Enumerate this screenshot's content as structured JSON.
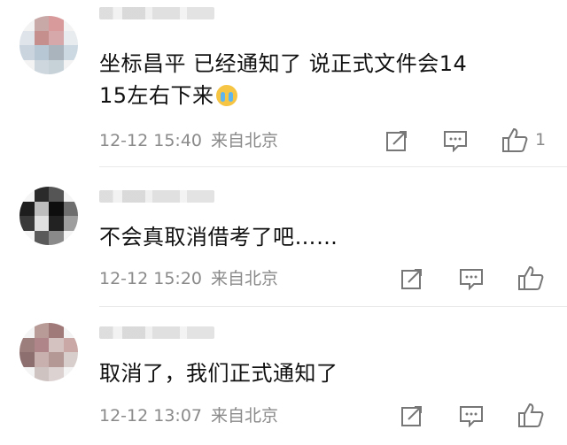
{
  "comments": [
    {
      "text_line1": "坐标昌平 已经通知了 说正式文件会14",
      "text_line2": "15左右下来",
      "time": "12-12 15:40",
      "location": "来自北京",
      "like_count": "1",
      "avatar_colors": [
        "#f3f3f3",
        "#c9a9a8",
        "#d99a9c",
        "#f3f3f3",
        "#dfe4ea",
        "#c48f8d",
        "#d6a8a9",
        "#e8ecef",
        "#c9d4de",
        "#b7c7d4",
        "#a9b4bd",
        "#cdd9e2",
        "#f3f3f3",
        "#cfd7de",
        "#c6d1d8",
        "#f3f3f3"
      ]
    },
    {
      "text_line1": "不会真取消借考了吧……",
      "time": "12-12 15:20",
      "location": "来自北京",
      "avatar_colors": [
        "#f5f5f5",
        "#2a2a2a",
        "#555555",
        "#f5f5f5",
        "#1e1e1e",
        "#bdbdbd",
        "#0e0e0e",
        "#6e6e6e",
        "#3a3a3a",
        "#e0e0e0",
        "#222222",
        "#9e9e9e",
        "#f5f5f5",
        "#5a5a5a",
        "#8a8a8a",
        "#f5f5f5"
      ]
    },
    {
      "text_line1": "取消了，我们正式通知了",
      "time": "12-12 13:07",
      "location": "来自北京",
      "avatar_colors": [
        "#f4f4f4",
        "#b89a96",
        "#a07a78",
        "#f4f4f4",
        "#9c7e7c",
        "#b0858a",
        "#d4c2c0",
        "#c9a8a6",
        "#8e6f6f",
        "#c7b0ae",
        "#b39896",
        "#d8cfcd",
        "#f4f4f4",
        "#cfc3c2",
        "#dcd2d1",
        "#f4f4f4"
      ]
    }
  ]
}
